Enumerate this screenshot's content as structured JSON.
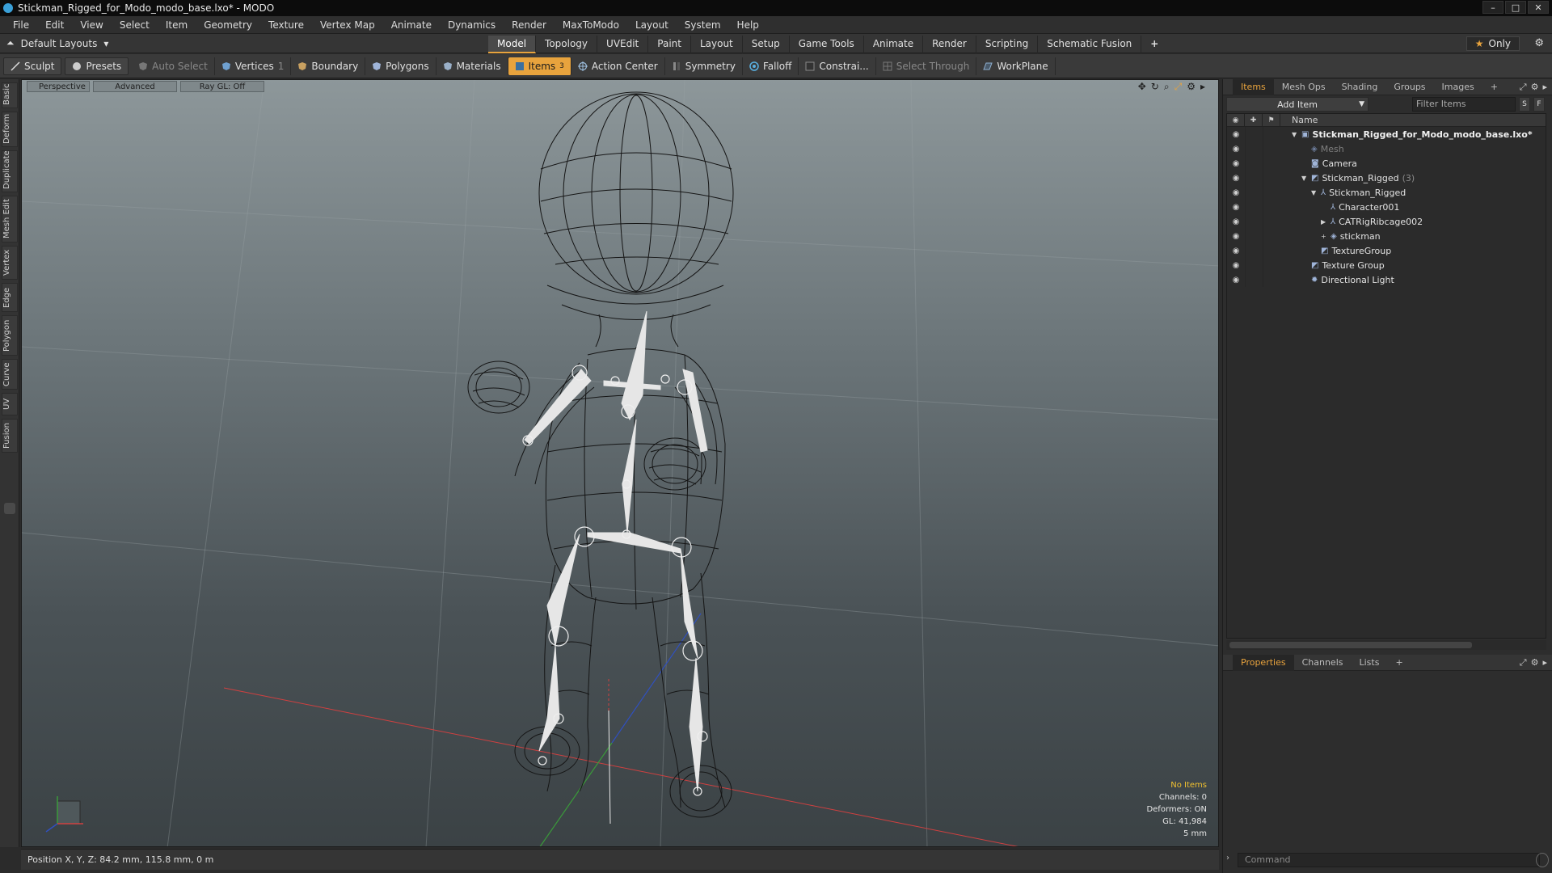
{
  "window": {
    "title": "Stickman_Rigged_for_Modo_modo_base.lxo* - MODO",
    "min": "–",
    "max": "□",
    "close": "✕"
  },
  "menu": [
    "File",
    "Edit",
    "View",
    "Select",
    "Item",
    "Geometry",
    "Texture",
    "Vertex Map",
    "Animate",
    "Dynamics",
    "Render",
    "MaxToModo",
    "Layout",
    "System",
    "Help"
  ],
  "layoutbar": {
    "default_layouts": "Default Layouts",
    "tabs": [
      "Model",
      "Topology",
      "UVEdit",
      "Paint",
      "Layout",
      "Setup",
      "Game Tools",
      "Animate",
      "Render",
      "Scripting",
      "Schematic Fusion"
    ],
    "active_tab": "Model",
    "plus": "+",
    "only": "Only"
  },
  "toolbar": {
    "sculpt": "Sculpt",
    "presets": "Presets",
    "auto_select": "Auto Select",
    "vertices": "Vertices",
    "vertices_count": "1",
    "boundary": "Boundary",
    "polygons": "Polygons",
    "materials": "Materials",
    "items": "Items",
    "items_count": "3",
    "action_center": "Action Center",
    "symmetry": "Symmetry",
    "falloff": "Falloff",
    "constraints": "Constrai...",
    "select_through": "Select Through",
    "workplane": "WorkPlane"
  },
  "left_tabs": [
    "Basic",
    "Deform",
    "Duplicate",
    "Mesh Edit",
    "Vertex",
    "Edge",
    "Polygon",
    "Curve",
    "UV",
    "Fusion"
  ],
  "viewport": {
    "view": "Perspective",
    "shading": "Advanced",
    "raygl": "Ray GL: Off",
    "info": {
      "no_items": "No Items",
      "channels": "Channels: 0",
      "deformers": "Deformers: ON",
      "gl": "GL: 41,984",
      "scale": "5 mm"
    }
  },
  "status": {
    "position": "Position X, Y, Z:  84.2 mm, 115.8 mm, 0 m"
  },
  "items_panel": {
    "tabs": [
      "Items",
      "Mesh Ops",
      "Shading",
      "Groups",
      "Images"
    ],
    "active_tab": "Items",
    "plus": "+",
    "add_item": "Add Item",
    "filter_placeholder": "Filter Items",
    "s_btn": "S",
    "f_btn": "F",
    "name_header": "Name",
    "tree": [
      {
        "label": "Stickman_Rigged_for_Modo_modo_base.lxo*",
        "indent": 0,
        "bold": true,
        "icon": "scene-icon",
        "toggle": "▼"
      },
      {
        "label": "Mesh",
        "indent": 1,
        "dim": true,
        "icon": "mesh-icon",
        "toggle": ""
      },
      {
        "label": "Camera",
        "indent": 1,
        "icon": "camera-icon",
        "toggle": ""
      },
      {
        "label": "Stickman_Rigged",
        "count": "(3)",
        "indent": 1,
        "icon": "group-icon",
        "toggle": "▼"
      },
      {
        "label": "Stickman_Rigged",
        "indent": 2,
        "icon": "locator-icon",
        "toggle": "▼"
      },
      {
        "label": "Character001",
        "indent": 3,
        "icon": "locator-icon",
        "toggle": ""
      },
      {
        "label": "CATRigRibcage002",
        "indent": 3,
        "icon": "locator-icon",
        "toggle": "▶"
      },
      {
        "label": "stickman",
        "indent": 3,
        "icon": "mesh-icon",
        "toggle": "+"
      },
      {
        "label": "TextureGroup",
        "indent": 2,
        "icon": "group-icon",
        "toggle": ""
      },
      {
        "label": "Texture Group",
        "indent": 1,
        "icon": "group-icon",
        "toggle": ""
      },
      {
        "label": "Directional Light",
        "indent": 1,
        "icon": "light-icon",
        "toggle": ""
      }
    ]
  },
  "props_panel": {
    "tabs": [
      "Properties",
      "Channels",
      "Lists"
    ],
    "active_tab": "Properties",
    "plus": "+"
  },
  "command": {
    "placeholder": "Command"
  },
  "colors": {
    "accent": "#e8a33d",
    "viewport_top": "#8d979a",
    "viewport_bottom": "#3b4245"
  }
}
